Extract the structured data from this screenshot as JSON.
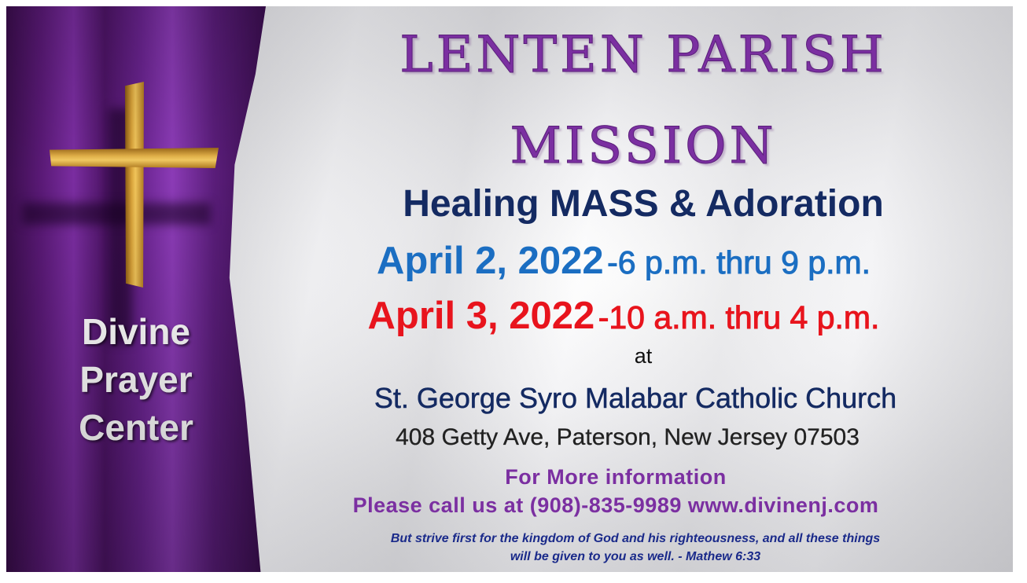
{
  "banner": {
    "org_name": [
      "Divine",
      "Prayer",
      "Center"
    ],
    "title_line1": "LENTEN PARISH",
    "title_line2": "MISSION",
    "subtitle": "Healing MASS & Adoration",
    "dates": [
      {
        "date": "April 2, 2022",
        "time": "-6 p.m. thru 9 p.m.",
        "color": "#1b6ec2"
      },
      {
        "date": "April 3, 2022",
        "time": "-10 a.m. thru 4 p.m.",
        "color": "#e8141d"
      }
    ],
    "at": "at",
    "church": "St. George Syro Malabar Catholic Church",
    "address": "408 Getty Ave, Paterson, New Jersey 07503",
    "info_line1": "For More information",
    "info_line2": "Please call us at (908)-835-9989  www.divinenj.com",
    "quote_line1": "But strive first for the kingdom of God and his righteousness,  and all these things",
    "quote_line2": "will be given to you as well. -  Mathew 6:33"
  },
  "colors": {
    "title": "#7b2fa1",
    "subtitle": "#142a62",
    "purple_drape": "#5b1a78",
    "cross_gold": "#d9a33a"
  },
  "icons": [
    "cross-icon"
  ]
}
